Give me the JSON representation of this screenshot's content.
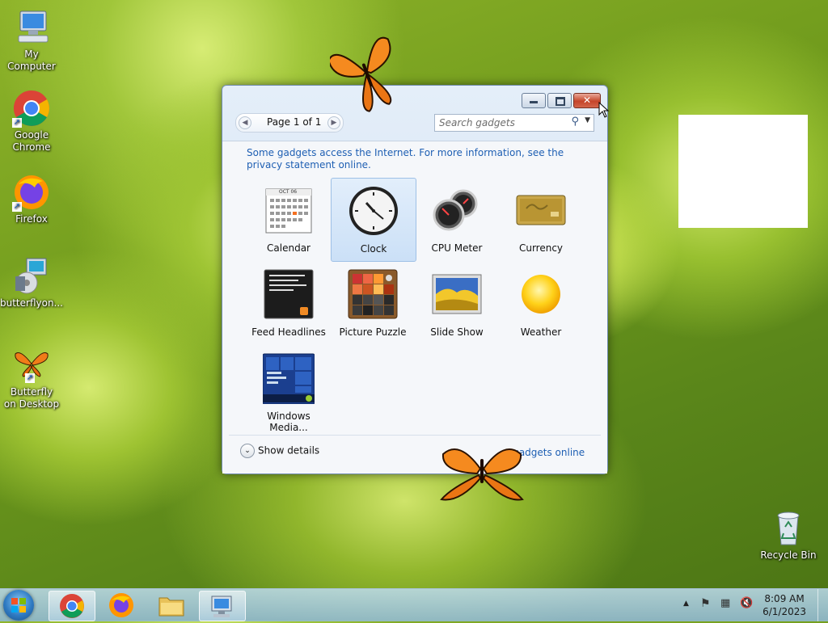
{
  "desktop_icons": [
    {
      "label": "My Computer"
    },
    {
      "label": "Google Chrome"
    },
    {
      "label": "Firefox"
    },
    {
      "label": "butterflyon..."
    },
    {
      "label": "Butterfly on Desktop"
    },
    {
      "label": "Recycle Bin"
    }
  ],
  "gadget_window": {
    "pager": {
      "label": "Page 1 of 1"
    },
    "search": {
      "placeholder": "Search gadgets"
    },
    "info_text": "Some gadgets access the Internet.  For more information, see the privacy statement online.",
    "gadgets": [
      {
        "label": "Calendar",
        "icon": "calendar-icon"
      },
      {
        "label": "Clock",
        "icon": "clock-icon",
        "selected": true
      },
      {
        "label": "CPU Meter",
        "icon": "cpu-meter-icon"
      },
      {
        "label": "Currency",
        "icon": "currency-icon"
      },
      {
        "label": "Feed Headlines",
        "icon": "feed-headlines-icon"
      },
      {
        "label": "Picture Puzzle",
        "icon": "picture-puzzle-icon"
      },
      {
        "label": "Slide Show",
        "icon": "slide-show-icon"
      },
      {
        "label": "Weather",
        "icon": "weather-icon"
      },
      {
        "label": "Windows Media...",
        "icon": "windows-media-center-icon"
      }
    ],
    "calendar_month": "OCT 06",
    "show_details": "Show details",
    "more_link": "e gadgets online"
  },
  "taskbar": {
    "apps": [
      "start-button",
      "chrome-icon",
      "firefox-icon",
      "file-explorer-icon",
      "remote-desktop-icon"
    ],
    "time": "8:09 AM",
    "date": "6/1/2023"
  },
  "colors": {
    "link": "#1e5fb3",
    "selection": "#cbe0f7"
  }
}
